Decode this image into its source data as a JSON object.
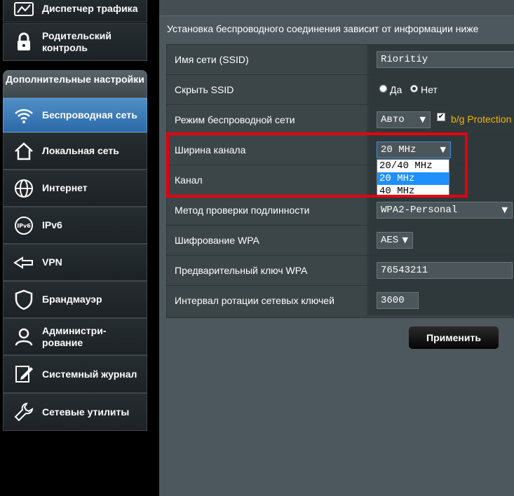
{
  "sidebar": {
    "top_items": [
      {
        "label": "Диспетчер трафика",
        "icon": "traffic-icon"
      },
      {
        "label": "Родительский контроль",
        "icon": "lock-icon"
      }
    ],
    "advanced_header": "Дополнительные настройки",
    "items": [
      {
        "label": "Беспроводная сеть",
        "icon": "wifi-icon"
      },
      {
        "label": "Локальная сеть",
        "icon": "home-icon"
      },
      {
        "label": "Интернет",
        "icon": "globe-icon"
      },
      {
        "label": "IPv6",
        "icon": "ipv6-icon"
      },
      {
        "label": "VPN",
        "icon": "vpn-icon"
      },
      {
        "label": "Брандмауэр",
        "icon": "shield-icon"
      },
      {
        "label": "Администри-рование",
        "icon": "user-icon"
      },
      {
        "label": "Системный журнал",
        "icon": "log-icon"
      },
      {
        "label": "Сетевые утилиты",
        "icon": "wrench-icon"
      }
    ]
  },
  "main": {
    "description": "Установка беспроводного соединения зависит от информации ниже",
    "ssid": {
      "label": "Имя сети (SSID)",
      "value": "Rioritiy"
    },
    "hide_ssid": {
      "label": "Скрыть SSID",
      "yes": "Да",
      "no": "Нет",
      "selected": "Нет"
    },
    "wireless_mode": {
      "label": "Режим беспроводной сети",
      "value": "Авто",
      "checkbox_label": "b/g Protection",
      "checked": true
    },
    "channel_width": {
      "label": "Ширина канала",
      "value": "20 MHz",
      "options": [
        "20/40 MHz",
        "20 MHz",
        "40 MHz"
      ],
      "selected_option": "20 MHz"
    },
    "channel": {
      "label": "Канал"
    },
    "auth_method": {
      "label": "Метод проверки подлинности",
      "value": "WPA2-Personal"
    },
    "wpa_encryption": {
      "label": "Шифрование WPA",
      "value": "AES"
    },
    "wpa_key": {
      "label": "Предварительный ключ WPA",
      "value": "76543211"
    },
    "key_rotation": {
      "label": "Интервал ротации сетевых ключей",
      "value": "3600"
    },
    "apply_label": "Применить"
  },
  "colors": {
    "accent": "#f6b300",
    "highlight": "#e3000f",
    "active_nav": "#3d7dba"
  }
}
